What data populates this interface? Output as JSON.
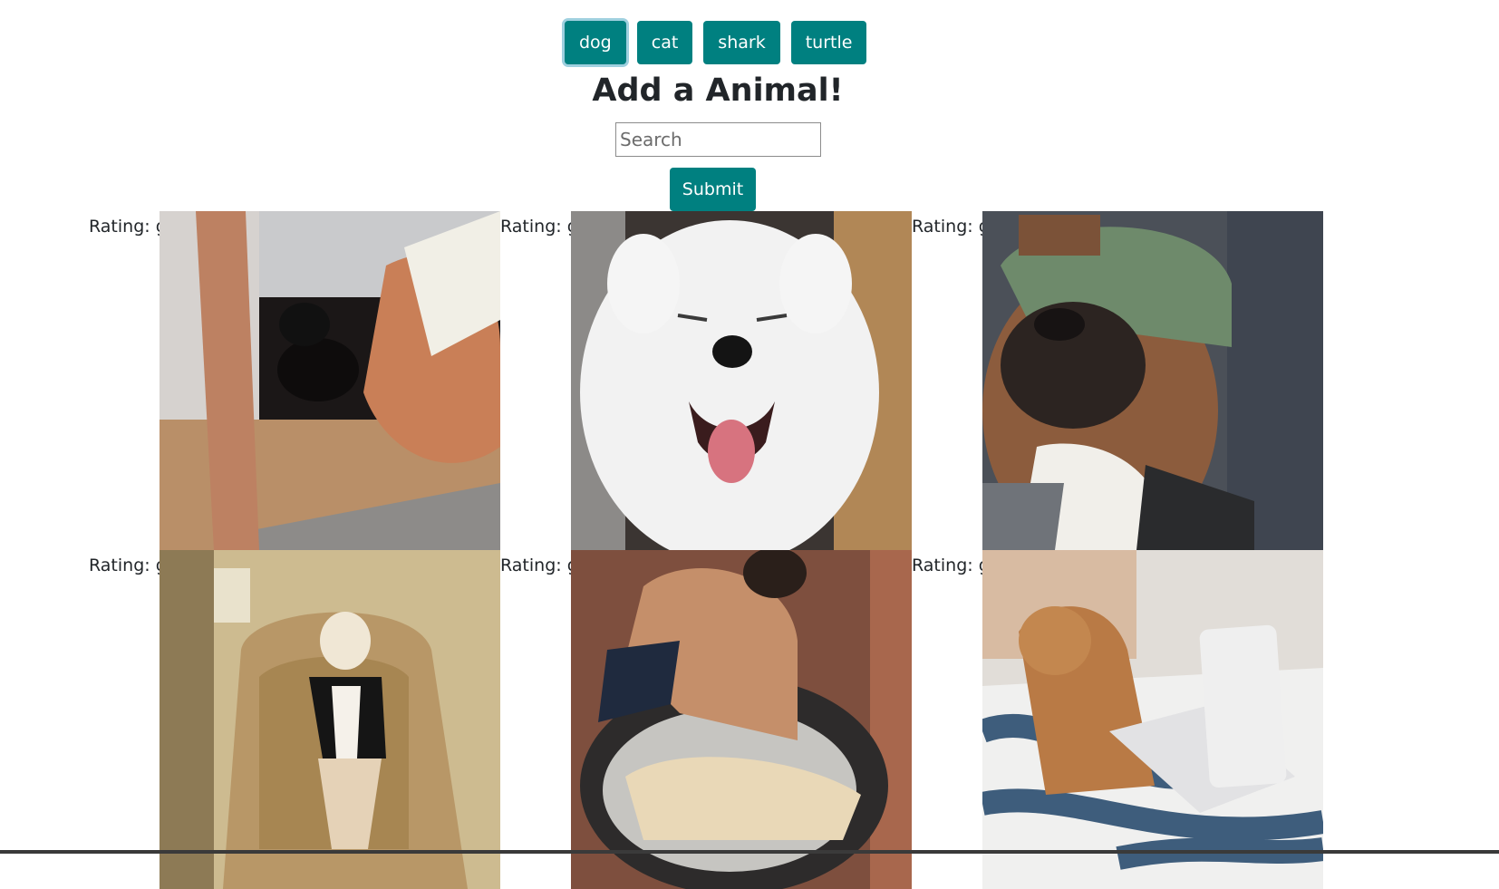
{
  "nav": {
    "buttons": [
      {
        "label": "dog",
        "active": true
      },
      {
        "label": "cat",
        "active": false
      },
      {
        "label": "shark",
        "active": false
      },
      {
        "label": "turtle",
        "active": false
      }
    ]
  },
  "form": {
    "heading": "Add a Animal!",
    "search_placeholder": "Search",
    "search_value": "",
    "submit_label": "Submit"
  },
  "gifs": [
    {
      "rating": "Rating: g"
    },
    {
      "rating": "Rating: g"
    },
    {
      "rating": "Rating: g"
    },
    {
      "rating": "Rating: g"
    },
    {
      "rating": "Rating: g"
    },
    {
      "rating": "Rating: g"
    }
  ],
  "colors": {
    "button": "#008080",
    "heading": "#212529"
  }
}
